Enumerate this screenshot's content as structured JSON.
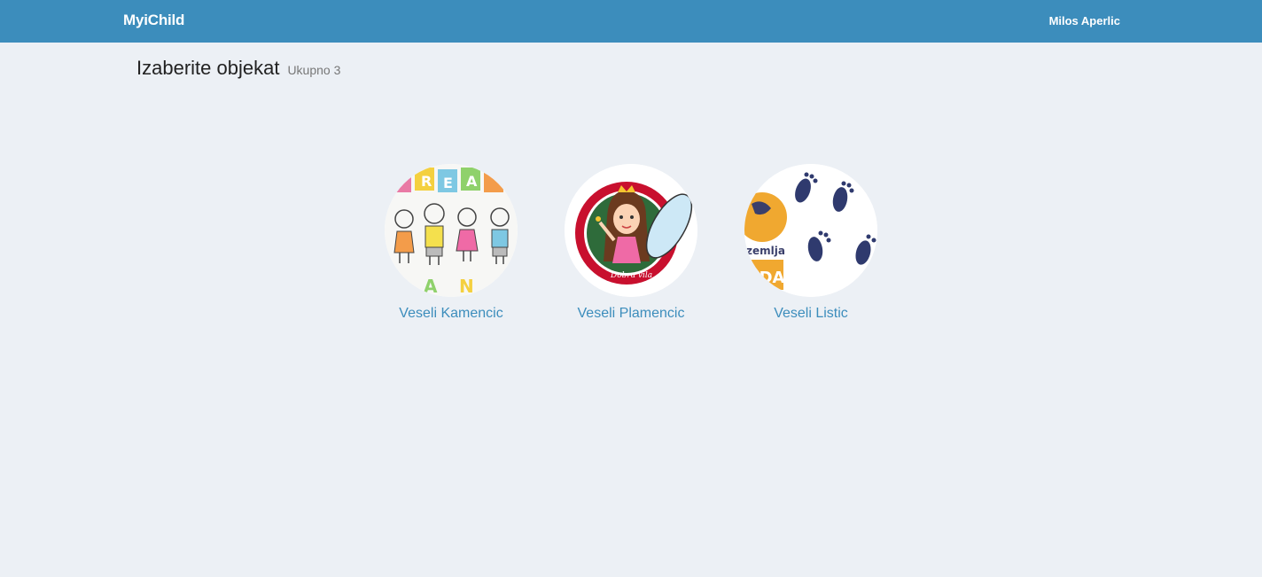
{
  "navbar": {
    "brand": "MyiChild",
    "user_name": "Milos Aperlic"
  },
  "header": {
    "title": "Izaberite objekat",
    "subtitle": "Ukupno 3"
  },
  "objects": [
    {
      "name": "Veseli Kamencic",
      "image": "children-drawing-logo"
    },
    {
      "name": "Veseli Plamencic",
      "image": "fairy-girl-logo"
    },
    {
      "name": "Veseli Listic",
      "image": "footprints-logo"
    }
  ],
  "colors": {
    "navbar": "#3c8dbc",
    "background": "#ecf0f5",
    "link": "#3c8dbc"
  }
}
